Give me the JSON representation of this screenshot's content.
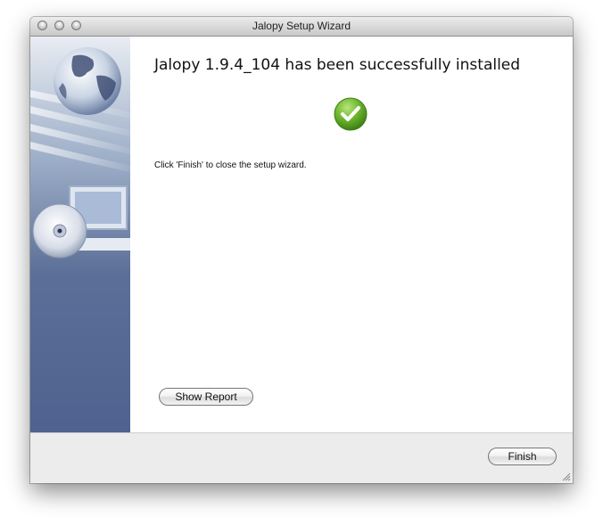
{
  "window": {
    "title": "Jalopy Setup Wizard"
  },
  "content": {
    "heading": "Jalopy 1.9.4_104 has been successfully installed",
    "instruction": "Click 'Finish' to close the setup wizard."
  },
  "buttons": {
    "show_report": "Show Report",
    "finish": "Finish"
  },
  "icons": {
    "success": "check-icon",
    "sidebar_art": [
      "globe-icon",
      "computer-monitor-icon",
      "cd-disc-icon"
    ]
  },
  "colors": {
    "sidebar_blue": "#4f6290",
    "success_green": "#6bb52c",
    "footer_gray": "#ececec"
  }
}
